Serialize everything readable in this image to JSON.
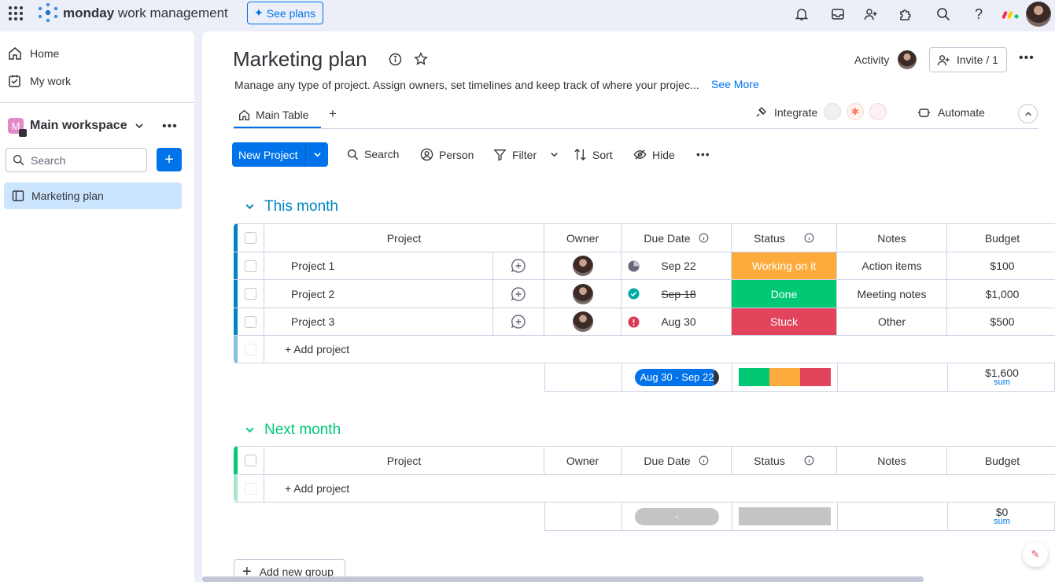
{
  "app": {
    "brand_bold": "monday",
    "brand_rest": " work management",
    "see_plans": "See plans"
  },
  "sidebar": {
    "home": "Home",
    "my_work": "My work",
    "workspace_initial": "M",
    "workspace_name": "Main workspace",
    "search_placeholder": "Search",
    "board": "Marketing plan"
  },
  "board": {
    "title": "Marketing plan",
    "description": "Manage any type of project. Assign owners, set timelines and keep track of where your projec...",
    "see_more": "See More",
    "activity": "Activity",
    "invite": "Invite / 1",
    "tab_main": "Main Table",
    "integrate": "Integrate",
    "automate": "Automate"
  },
  "toolbar": {
    "new_project": "New Project",
    "search": "Search",
    "person": "Person",
    "filter": "Filter",
    "sort": "Sort",
    "hide": "Hide"
  },
  "columns": [
    "Project",
    "Owner",
    "Due Date",
    "Status",
    "Notes",
    "Budget"
  ],
  "groups": [
    {
      "title": "This month",
      "color": "#037f4c",
      "rows": [
        {
          "name": "Project 1",
          "due": "Sep 22",
          "status": "Working on it",
          "status_color": "#fdab3d",
          "notes": "Action items",
          "budget": "$100"
        },
        {
          "name": "Project 2",
          "due": "Sep 18",
          "status": "Done",
          "status_color": "#00c875",
          "notes": "Meeting notes",
          "budget": "$1,000"
        },
        {
          "name": "Project 3",
          "due": "Aug 30",
          "status": "Stuck",
          "status_color": "#e2445c",
          "notes": "Other",
          "budget": "$500"
        }
      ],
      "add_label": "+ Add project",
      "timeline": "Aug 30 - Sep 22",
      "sum_value": "$1,600",
      "sum_label": "sum"
    },
    {
      "title": "Next month",
      "rows": [],
      "add_label": "+ Add project",
      "timeline": "-",
      "sum_value": "$0",
      "sum_label": "sum"
    }
  ],
  "add_group": "Add new group",
  "colors": {
    "primary": "#0073ea",
    "group1": "#0086c0",
    "group1_title": "#0086c0",
    "group2": "#00c875",
    "group2_title": "#00c875"
  }
}
